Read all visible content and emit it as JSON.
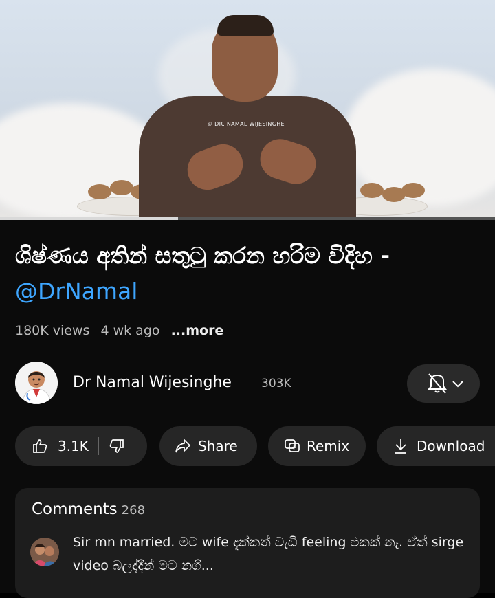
{
  "video": {
    "watermark": "© DR. NAMAL WIJESINGHE",
    "progress_fraction": 0.36
  },
  "title": {
    "text": "ශිෂ්ණය අතින් සතුටු කරන හරිම විදිහ -",
    "mention": "@DrNamal"
  },
  "meta": {
    "views": "180K views",
    "age": "4 wk ago",
    "more": "...more"
  },
  "channel": {
    "name": "Dr Namal Wijesinghe",
    "subscribers": "303K",
    "bell_icon": "bell-off-icon",
    "dropdown_icon": "chevron-down-icon"
  },
  "actions": {
    "likes": "3.1K",
    "share": "Share",
    "remix": "Remix",
    "download": "Download"
  },
  "comments": {
    "label": "Comments",
    "count": "268",
    "top_comment": "Sir mn married. මට wife දැක්කත් වැඩි feeling එකක් නෑ. ඒත් sirge video බලද්දීන් මට නගි..."
  },
  "colors": {
    "mention": "#3ea6ff",
    "panel_bg": "#0b0b0b",
    "pill_bg": "#262626"
  }
}
